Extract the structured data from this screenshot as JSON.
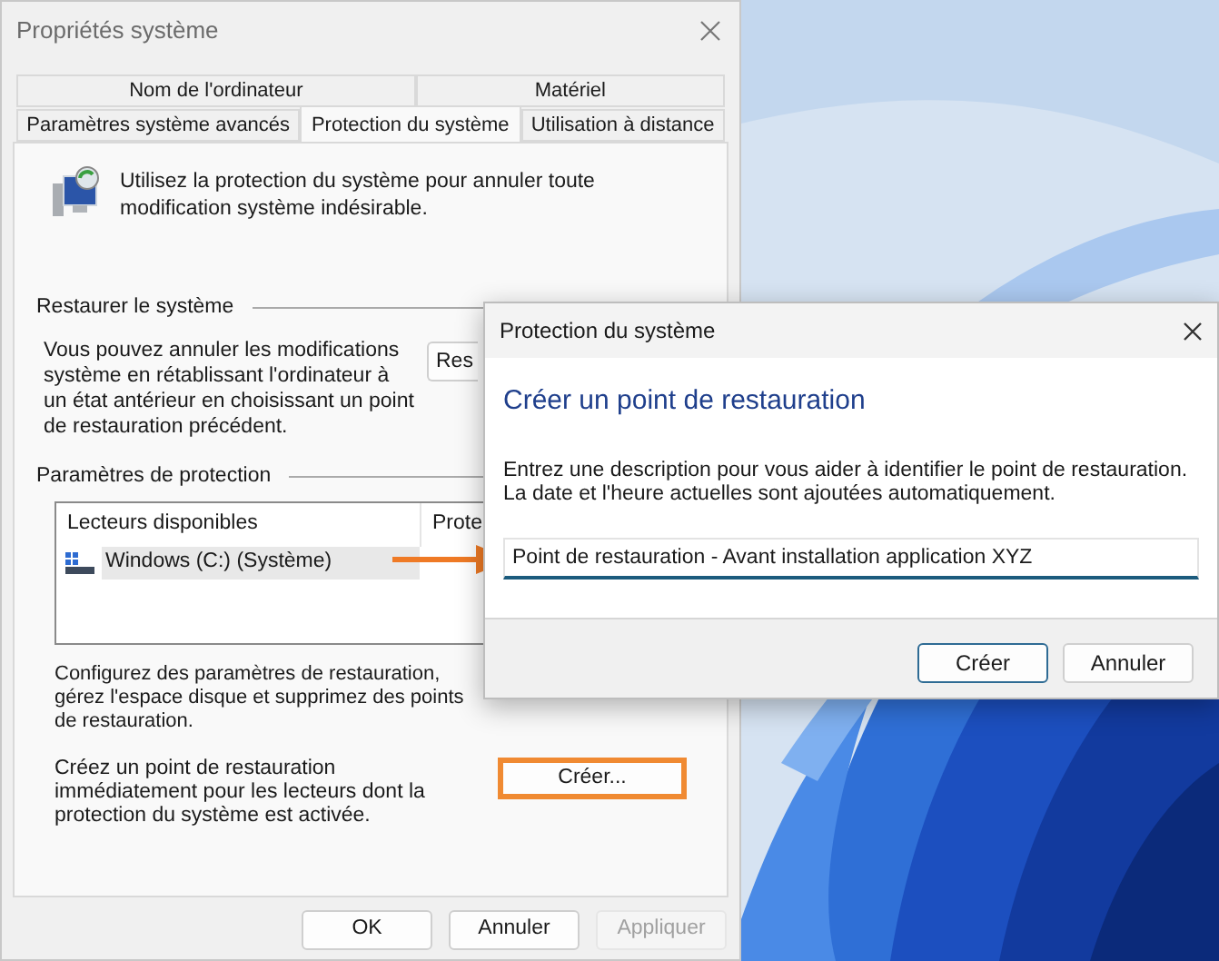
{
  "main_window": {
    "title": "Propriétés système",
    "tab_rows": [
      [
        {
          "label": "Nom de l'ordinateur",
          "selected": false
        },
        {
          "label": "Matériel",
          "selected": false
        }
      ],
      [
        {
          "label": "Paramètres système avancés",
          "selected": false
        },
        {
          "label": "Protection du système",
          "selected": true
        },
        {
          "label": "Utilisation à distance",
          "selected": false
        }
      ]
    ],
    "intro": "Utilisez la protection du système pour annuler toute modification système indésirable.",
    "restore": {
      "heading": "Restaurer le système",
      "text": "Vous pouvez annuler les modifications système en rétablissant l'ordinateur à un état antérieur en choisissant un point de restauration précédent.",
      "button": "Res"
    },
    "protection": {
      "heading": "Paramètres de protection",
      "columns": [
        "Lecteurs disponibles",
        "Prote"
      ],
      "rows": [
        {
          "cells": [
            "Windows (C:) (Système)"
          ],
          "selected": true
        }
      ],
      "configure_text": "Configurez des paramètres de restauration, gérez l'espace disque et supprimez des points de restauration.",
      "create_text": "Créez un point de restauration immédiatement pour les lecteurs dont la protection du système est activée.",
      "create_button": {
        "label": "Créer...",
        "highlighted": true
      }
    },
    "buttons": [
      {
        "label": "OK",
        "disabled": false
      },
      {
        "label": "Annuler",
        "disabled": false
      },
      {
        "label": "Appliquer",
        "disabled": true
      }
    ]
  },
  "dialog": {
    "title": "Protection du système",
    "heading": "Créer un point de restauration",
    "description": "Entrez une description pour vous aider à identifier le point de restauration. La date et l'heure actuelles sont ajoutées automatiquement.",
    "input": {
      "value": "Point de restauration - Avant installation application XYZ"
    },
    "buttons": [
      {
        "label": "Créer",
        "default": true
      },
      {
        "label": "Annuler",
        "default": false
      }
    ]
  }
}
